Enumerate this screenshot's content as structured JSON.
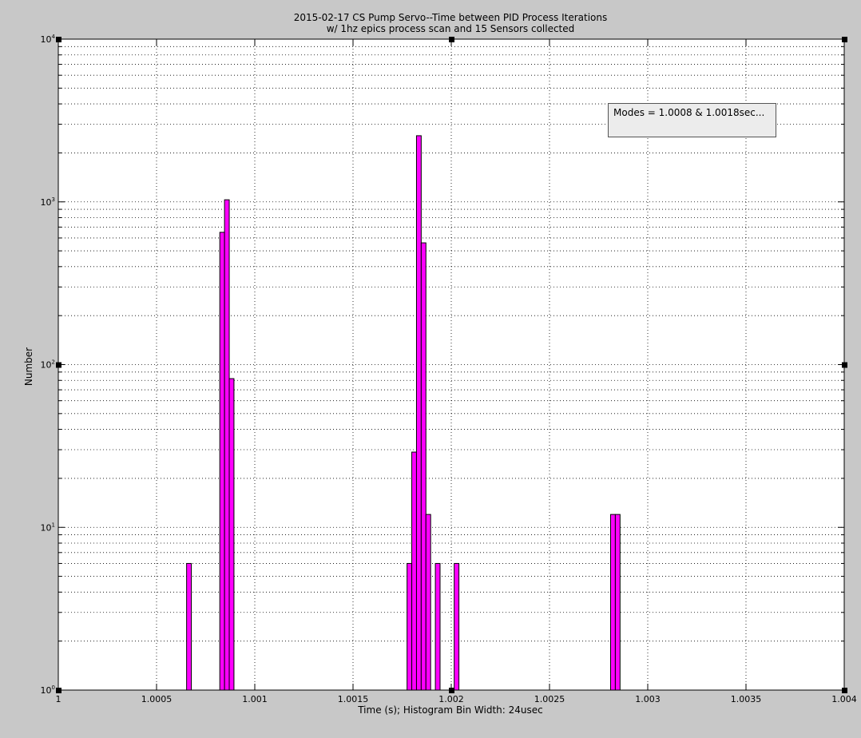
{
  "chart_data": {
    "type": "bar",
    "title": "2015-02-17 CS Pump Servo--Time between PID Process Iterations",
    "subtitle": "w/ 1hz epics process scan and 15 Sensors collected",
    "xlabel": "Time (s); Histogram Bin Width: 24usec",
    "ylabel": "Number",
    "xlim": [
      1,
      1.004
    ],
    "ylim": [
      1,
      10000
    ],
    "yscale": "log",
    "grid": true,
    "bar_color": "#ff00ff",
    "bar_edge_color": "#000000",
    "bin_width": 2.4e-05,
    "xticks": [
      1,
      1.0005,
      1.001,
      1.0015,
      1.002,
      1.0025,
      1.003,
      1.0035,
      1.004
    ],
    "xtick_labels": [
      "1",
      "1.0005",
      "1.001",
      "1.0015",
      "1.002",
      "1.0025",
      "1.003",
      "1.0035",
      "1.004"
    ],
    "yticks": [
      1,
      10,
      100,
      1000,
      10000
    ],
    "ytick_labels": [
      "10^0",
      "10^1",
      "10^2",
      "10^3",
      "10^4"
    ],
    "x": [
      1.000665,
      1.000834,
      1.000858,
      1.000882,
      1.001787,
      1.001811,
      1.001835,
      1.001859,
      1.001883,
      1.001931,
      1.002027,
      1.002823,
      1.002847
    ],
    "values": [
      6,
      650,
      1030,
      82,
      6,
      29,
      2550,
      560,
      12,
      6,
      6,
      12,
      12
    ],
    "annotation": "Modes = 1.0008 & 1.0018sec..."
  }
}
